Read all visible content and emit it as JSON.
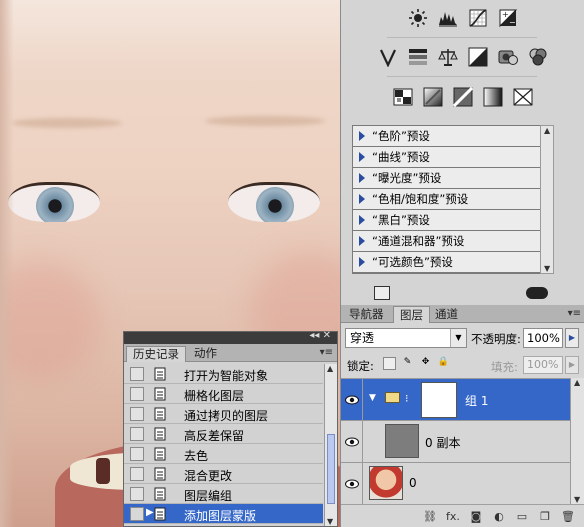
{
  "adjustments": {
    "row1_icons": [
      "brightness-contrast-icon",
      "levels-icon",
      "curves-icon",
      "exposure-icon"
    ],
    "row2_icons": [
      "vibrance-icon",
      "hue-saturation-icon",
      "color-balance-icon",
      "black-white-icon",
      "photo-filter-icon",
      "channel-mixer-icon"
    ],
    "row3_icons": [
      "invert-icon",
      "posterize-icon",
      "threshold-icon",
      "gradient-map-icon",
      "selective-color-icon"
    ],
    "presets": [
      "“色阶”预设",
      "“曲线”预设",
      "“曝光度”预设",
      "“色相/饱和度”预设",
      "“黑白”预设",
      "“通道混和器”预设",
      "“可选颜色”预设"
    ]
  },
  "layers_panel": {
    "tabs": [
      "导航器",
      "图层",
      "通道"
    ],
    "active_tab": "图层",
    "blend_mode": "穿透",
    "opacity_label": "不透明度:",
    "opacity_value": "100%",
    "lock_label": "锁定:",
    "fill_label": "填充:",
    "fill_value": "100%",
    "layers": [
      {
        "name": "组 1",
        "type": "group",
        "selected": true
      },
      {
        "name": "0 副本",
        "type": "layer",
        "selected": false
      },
      {
        "name": "0",
        "type": "layer",
        "selected": false
      }
    ],
    "footer_icons": [
      "link-icon",
      "fx-icon",
      "mask-icon",
      "adjustment-icon",
      "group-icon",
      "new-layer-icon",
      "trash-icon"
    ],
    "footer_fx_label": "fx."
  },
  "history_panel": {
    "tabs": [
      "历史记录",
      "动作"
    ],
    "active_tab": "历史记录",
    "items": [
      "打开为智能对象",
      "栅格化图层",
      "通过拷贝的图层",
      "高反差保留",
      "去色",
      "混合更改",
      "图层编组",
      "添加图层蒙版"
    ],
    "selected_index": 7
  },
  "colors": {
    "selection": "#3567c8",
    "panel_bg": "#d6d6d6",
    "preset_triangle": "#2a4da0"
  }
}
